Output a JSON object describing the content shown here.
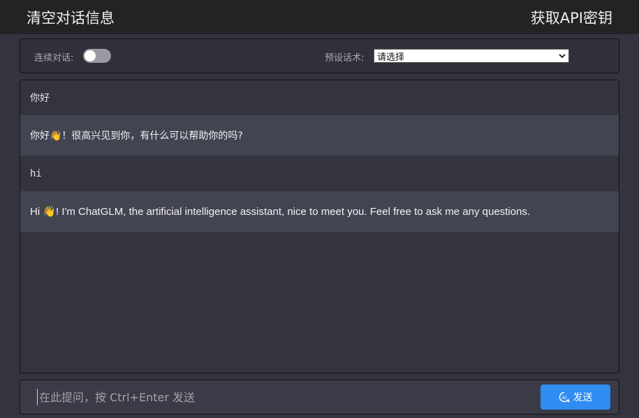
{
  "header": {
    "clear_label": "清空对话信息",
    "api_key_label": "获取API密钥"
  },
  "settings": {
    "continuous_label": "连续对话:",
    "continuous_enabled": false,
    "preset_label": "预设话术:",
    "preset_selected": "请选择"
  },
  "messages": [
    {
      "role": "user",
      "text": "你好"
    },
    {
      "role": "assistant",
      "text": "你好👋！很高兴见到你，有什么可以帮助你的吗?"
    },
    {
      "role": "user",
      "text": "hi"
    },
    {
      "role": "assistant",
      "text": "Hi 👋! I'm ChatGLM, the artificial intelligence assistant, nice to meet you. Feel free to ask me any questions."
    }
  ],
  "input": {
    "placeholder": "在此提问，按 Ctrl+Enter 发送",
    "value": ""
  },
  "send": {
    "label": "发送",
    "icon": "ai-chat-icon"
  },
  "colors": {
    "topbar": "#232325",
    "background": "#34343f",
    "assistant_bubble": "#434452",
    "send_button": "#2f8cf0"
  }
}
